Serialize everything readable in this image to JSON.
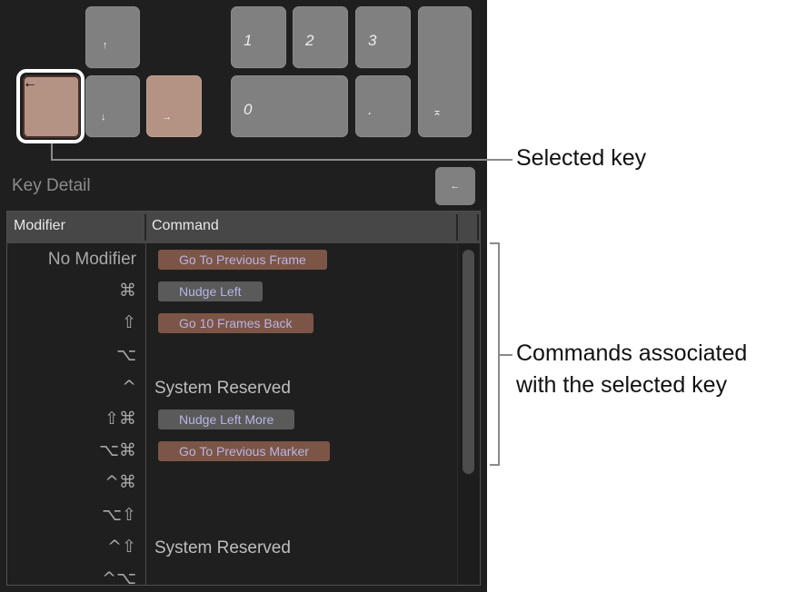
{
  "keyboard": {
    "arrow_keys": {
      "up": "↑",
      "down": "↓",
      "left": "←",
      "right": "→"
    },
    "numpad": {
      "one": "1",
      "two": "2",
      "three": "3",
      "zero": "0",
      "decimal": ".",
      "enter": "⌅"
    },
    "selected_key": "left-arrow"
  },
  "key_detail": {
    "title": "Key Detail",
    "preview_glyph": "←",
    "columns": {
      "modifier": "Modifier",
      "command": "Command"
    },
    "rows": [
      {
        "modifier": "No Modifier",
        "command": "Go To Previous Frame",
        "style": "brown"
      },
      {
        "modifier": "⌘",
        "command": "Nudge Left",
        "style": "gray"
      },
      {
        "modifier": "⇧",
        "command": "Go 10 Frames Back",
        "style": "brown"
      },
      {
        "modifier": "⌥",
        "command": "",
        "style": "none"
      },
      {
        "modifier": "^",
        "command": "System Reserved",
        "style": "plain"
      },
      {
        "modifier": "⇧⌘",
        "command": "Nudge Left More",
        "style": "gray"
      },
      {
        "modifier": "⌥⌘",
        "command": "Go To Previous Marker",
        "style": "brown"
      },
      {
        "modifier": "^⌘",
        "command": "",
        "style": "none"
      },
      {
        "modifier": "⌥⇧",
        "command": "",
        "style": "none"
      },
      {
        "modifier": "^⇧",
        "command": "System Reserved",
        "style": "plain"
      },
      {
        "modifier": "^⌥",
        "command": "",
        "style": "none"
      }
    ]
  },
  "callouts": {
    "selected_key": "Selected key",
    "commands_line1": "Commands associated",
    "commands_line2": "with the selected key"
  },
  "colors": {
    "command_key": "#b49385",
    "command_pill_brown": "#7c5546",
    "command_pill_gray": "#5a5a5a",
    "pill_text": "#b8b4e6"
  }
}
